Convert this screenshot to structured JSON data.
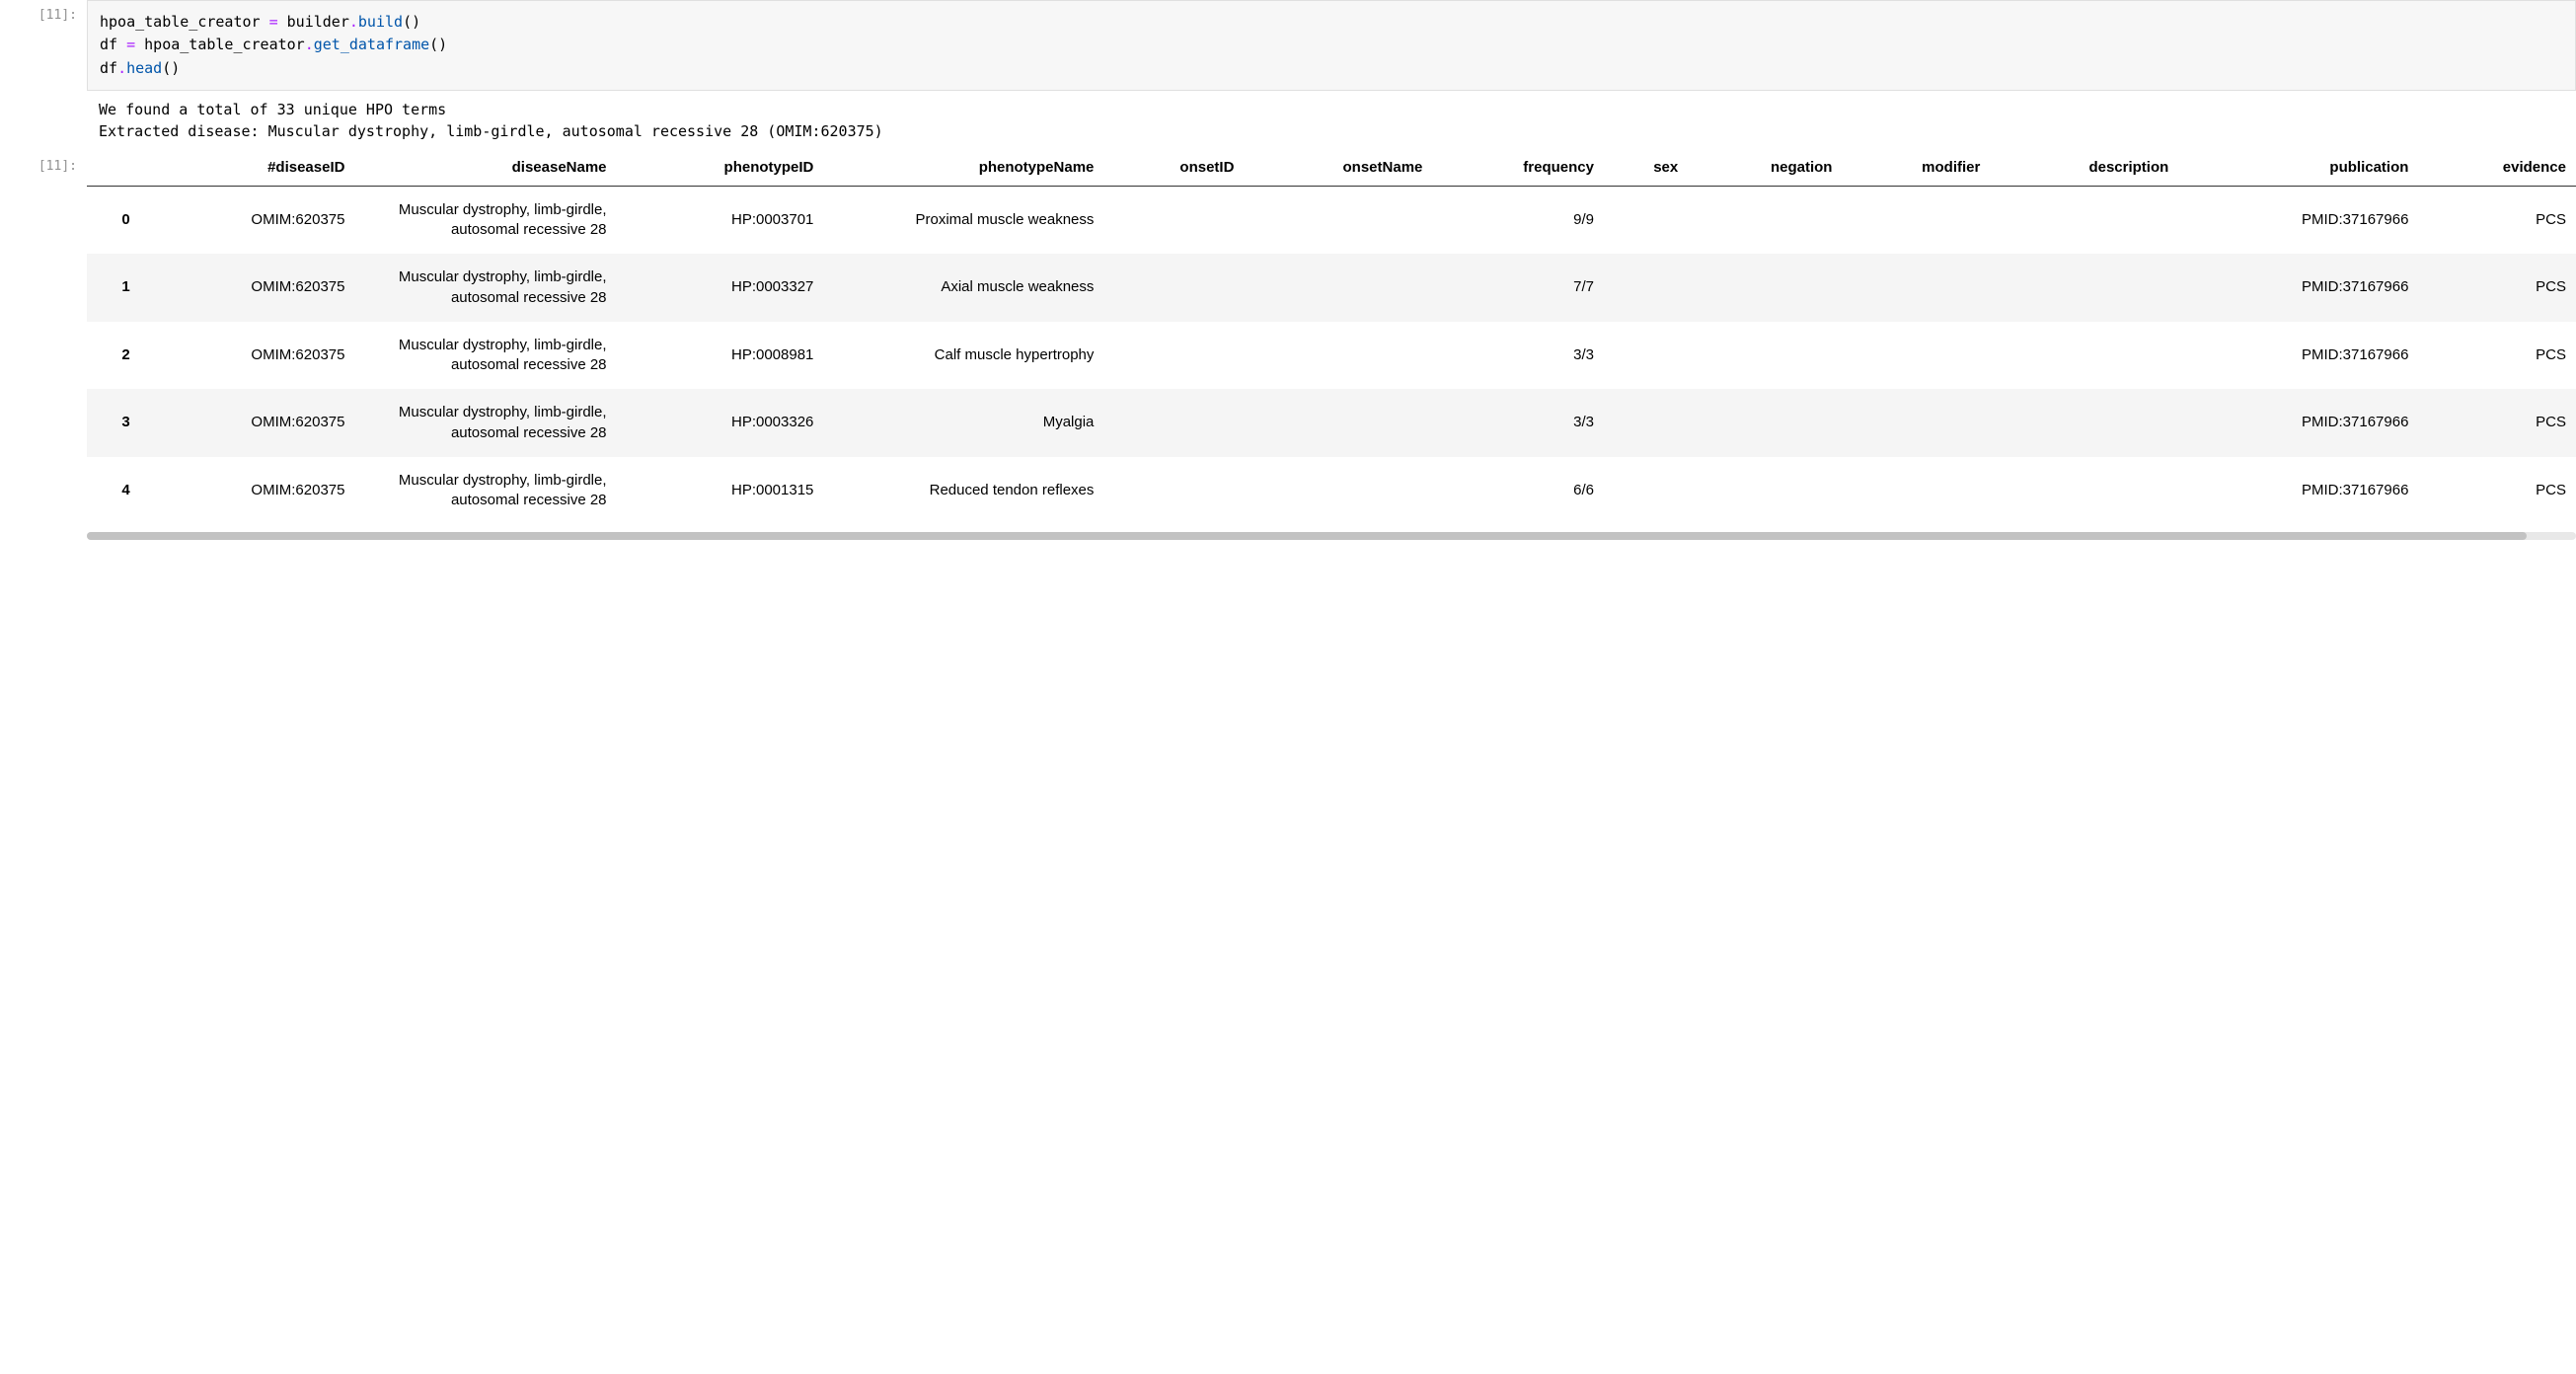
{
  "input_cell": {
    "prompt": "[11]:",
    "code_lines": [
      [
        {
          "t": "hpoa_table_creator ",
          "c": "tok-var"
        },
        {
          "t": "= ",
          "c": "tok-op"
        },
        {
          "t": "builder",
          "c": "tok-var"
        },
        {
          "t": ".",
          "c": "tok-dot"
        },
        {
          "t": "build",
          "c": "tok-method"
        },
        {
          "t": "()",
          "c": "tok-call"
        }
      ],
      [
        {
          "t": "df ",
          "c": "tok-var"
        },
        {
          "t": "= ",
          "c": "tok-op"
        },
        {
          "t": "hpoa_table_creator",
          "c": "tok-var"
        },
        {
          "t": ".",
          "c": "tok-dot"
        },
        {
          "t": "get_dataframe",
          "c": "tok-method"
        },
        {
          "t": "()",
          "c": "tok-call"
        }
      ],
      [
        {
          "t": "df",
          "c": "tok-var"
        },
        {
          "t": ".",
          "c": "tok-dot"
        },
        {
          "t": "head",
          "c": "tok-method"
        },
        {
          "t": "()",
          "c": "tok-call"
        }
      ]
    ]
  },
  "stdout": {
    "line1": "We found a total of 33 unique HPO terms",
    "line2": "Extracted disease: Muscular dystrophy, limb-girdle, autosomal recessive 28 (OMIM:620375)"
  },
  "output_prompt": "[11]:",
  "table": {
    "columns": [
      "#diseaseID",
      "diseaseName",
      "phenotypeID",
      "phenotypeName",
      "onsetID",
      "onsetName",
      "frequency",
      "sex",
      "negation",
      "modifier",
      "description",
      "publication",
      "evidence"
    ],
    "index": [
      "0",
      "1",
      "2",
      "3",
      "4"
    ],
    "rows": [
      {
        "diseaseID": "OMIM:620375",
        "diseaseName": "Muscular dystrophy, limb-girdle, autosomal recessive 28",
        "phenotypeID": "HP:0003701",
        "phenotypeName": "Proximal muscle weakness",
        "onsetID": "",
        "onsetName": "",
        "frequency": "9/9",
        "sex": "",
        "negation": "",
        "modifier": "",
        "description": "",
        "publication": "PMID:37167966",
        "evidence": "PCS"
      },
      {
        "diseaseID": "OMIM:620375",
        "diseaseName": "Muscular dystrophy, limb-girdle, autosomal recessive 28",
        "phenotypeID": "HP:0003327",
        "phenotypeName": "Axial muscle weakness",
        "onsetID": "",
        "onsetName": "",
        "frequency": "7/7",
        "sex": "",
        "negation": "",
        "modifier": "",
        "description": "",
        "publication": "PMID:37167966",
        "evidence": "PCS"
      },
      {
        "diseaseID": "OMIM:620375",
        "diseaseName": "Muscular dystrophy, limb-girdle, autosomal recessive 28",
        "phenotypeID": "HP:0008981",
        "phenotypeName": "Calf muscle hypertrophy",
        "onsetID": "",
        "onsetName": "",
        "frequency": "3/3",
        "sex": "",
        "negation": "",
        "modifier": "",
        "description": "",
        "publication": "PMID:37167966",
        "evidence": "PCS"
      },
      {
        "diseaseID": "OMIM:620375",
        "diseaseName": "Muscular dystrophy, limb-girdle, autosomal recessive 28",
        "phenotypeID": "HP:0003326",
        "phenotypeName": "Myalgia",
        "onsetID": "",
        "onsetName": "",
        "frequency": "3/3",
        "sex": "",
        "negation": "",
        "modifier": "",
        "description": "",
        "publication": "PMID:37167966",
        "evidence": "PCS"
      },
      {
        "diseaseID": "OMIM:620375",
        "diseaseName": "Muscular dystrophy, limb-girdle, autosomal recessive 28",
        "phenotypeID": "HP:0001315",
        "phenotypeName": "Reduced tendon reflexes",
        "onsetID": "",
        "onsetName": "",
        "frequency": "6/6",
        "sex": "",
        "negation": "",
        "modifier": "",
        "description": "",
        "publication": "PMID:37167966",
        "evidence": "PCS"
      }
    ]
  }
}
